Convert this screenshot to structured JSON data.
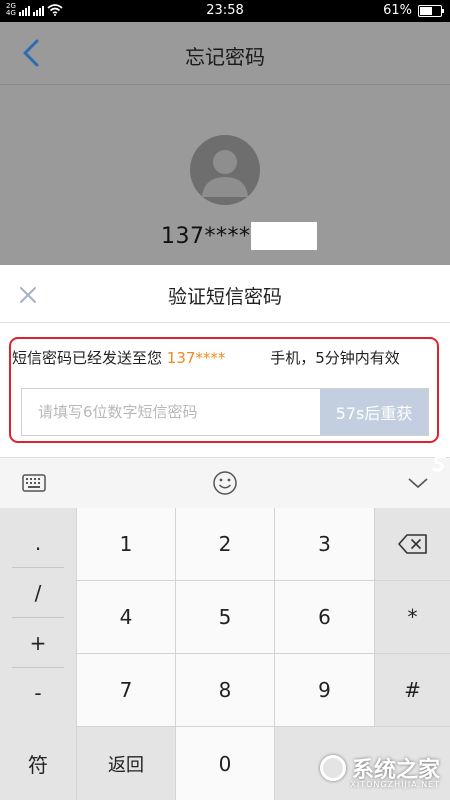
{
  "status_bar": {
    "left_labels": [
      "2G",
      "4G"
    ],
    "time": "23:58",
    "battery_percent": "61%",
    "battery_level": 0.61
  },
  "nav": {
    "title": "忘记密码",
    "back_icon": "chevron-left-icon"
  },
  "profile": {
    "phone_masked": "137****",
    "avatar_icon": "user-avatar-icon"
  },
  "dialog": {
    "title": "验证短信密码",
    "close_icon": "close-icon",
    "message_prefix": "短信密码已经发送至您",
    "message_phone": "137****",
    "message_suffix": "手机，5分钟内有效",
    "input_placeholder": "请填写6位数字短信密码",
    "resend_label": "57s后重获",
    "highlight_color": "#e0212e",
    "phone_color": "#f08a1c"
  },
  "keyboard_toolbar": {
    "icons": [
      "keyboard-icon",
      "emoji-icon",
      "chevron-down-icon"
    ]
  },
  "keyboard": {
    "side_keys": [
      ".",
      "/",
      "+",
      "-"
    ],
    "symbol_key": "符",
    "return_key": "返回",
    "digits": [
      "1",
      "2",
      "3",
      "4",
      "5",
      "6",
      "7",
      "8",
      "9",
      "0"
    ],
    "right_keys": [
      "*",
      "#"
    ],
    "backspace_icon": "backspace-icon"
  },
  "watermark": {
    "text": "系统之家",
    "sub": "XITONGZHIJIA.NET"
  }
}
